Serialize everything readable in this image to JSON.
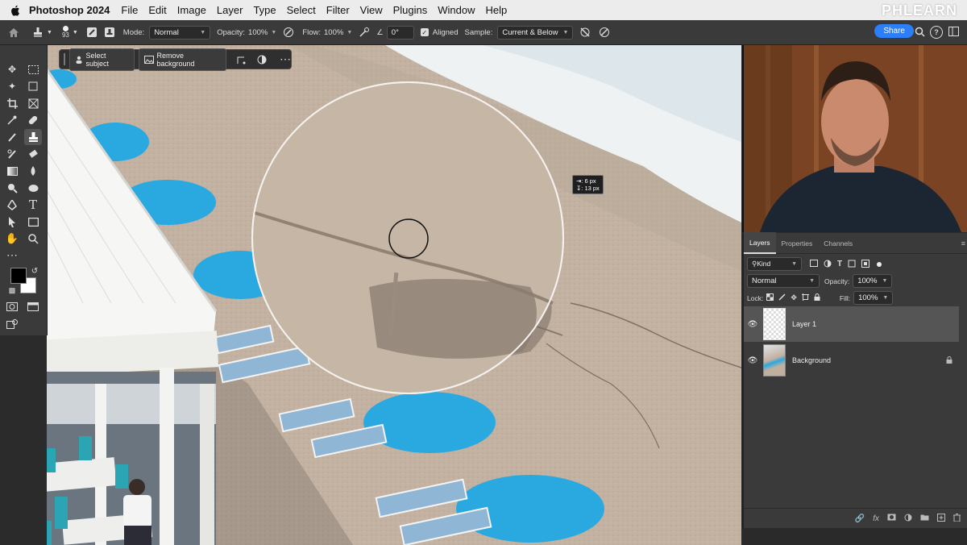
{
  "menubar": {
    "app_name": "Photoshop 2024",
    "items": [
      "File",
      "Edit",
      "Image",
      "Layer",
      "Type",
      "Select",
      "Filter",
      "View",
      "Plugins",
      "Window",
      "Help"
    ],
    "brand": "PHLEARN"
  },
  "options": {
    "brush_size": "93",
    "mode_label": "Mode:",
    "mode_value": "Normal",
    "opacity_label": "Opacity:",
    "opacity_value": "100%",
    "flow_label": "Flow:",
    "flow_value": "100%",
    "angle_value": "0°",
    "aligned_label": "Aligned",
    "sample_label": "Sample:",
    "sample_value": "Current & Below",
    "share_label": "Share"
  },
  "context_bar": {
    "select_subject": "Select subject",
    "remove_background": "Remove background"
  },
  "measure": {
    "line1": "6 px",
    "line2": "13 px"
  },
  "layers_panel": {
    "tabs": [
      "Layers",
      "Properties",
      "Channels"
    ],
    "filter_label": "Kind",
    "blend_mode": "Normal",
    "opacity_label": "Opacity:",
    "opacity_value": "100%",
    "lock_label": "Lock:",
    "fill_label": "Fill:",
    "fill_value": "100%",
    "layers": [
      {
        "name": "Layer 1"
      },
      {
        "name": "Background"
      }
    ]
  },
  "colors": {
    "accent": "#2d7ff9",
    "umbrella": "#2aa8e0",
    "sand": "#c4b3a3"
  }
}
